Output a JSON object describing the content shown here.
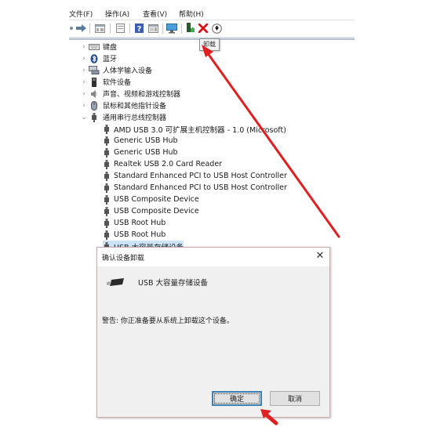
{
  "menubar": {
    "items": [
      {
        "label": "文件(F)",
        "display": "文件(F)"
      },
      {
        "label": "操作(A)"
      },
      {
        "label": "查看(V)"
      },
      {
        "label": "帮助(H)"
      }
    ]
  },
  "toolbar": {
    "buttons": [
      {
        "name": "back",
        "icon": "back-arrow-icon"
      },
      {
        "name": "forward",
        "icon": "forward-arrow-icon"
      },
      {
        "name": "show-hide-console-tree",
        "icon": "console-tree-icon"
      },
      {
        "name": "properties",
        "icon": "properties-icon"
      },
      {
        "name": "help",
        "icon": "help-icon"
      },
      {
        "name": "action-pane",
        "icon": "action-pane-icon"
      },
      {
        "name": "scan-hardware",
        "icon": "monitor-scan-icon"
      },
      {
        "name": "update-driver",
        "icon": "update-driver-icon"
      },
      {
        "name": "uninstall",
        "icon": "red-x-icon"
      },
      {
        "name": "disable",
        "icon": "down-arrow-circle-icon"
      }
    ],
    "tooltip": "卸载"
  },
  "tree": {
    "categories": [
      {
        "label": "键盘",
        "icon": "keyboard-icon",
        "expanded": false
      },
      {
        "label": "蓝牙",
        "icon": "bluetooth-icon",
        "expanded": false
      },
      {
        "label": "人体学输入设备",
        "icon": "hid-icon",
        "expanded": false
      },
      {
        "label": "软件设备",
        "icon": "software-device-icon",
        "expanded": false
      },
      {
        "label": "声音、视频和游戏控制器",
        "icon": "speaker-icon",
        "expanded": false
      },
      {
        "label": "鼠标和其他指针设备",
        "icon": "mouse-icon",
        "expanded": false
      },
      {
        "label": "通用串行总线控制器",
        "icon": "usb-plug-icon",
        "expanded": true
      }
    ],
    "usb_devices": [
      {
        "label": "AMD USB 3.0 可扩展主机控制器 - 1.0 (Microsoft)"
      },
      {
        "label": "Generic USB Hub"
      },
      {
        "label": "Generic USB Hub"
      },
      {
        "label": "Realtek USB 2.0 Card Reader"
      },
      {
        "label": "Standard Enhanced PCI to USB Host Controller"
      },
      {
        "label": "Standard Enhanced PCI to USB Host Controller"
      },
      {
        "label": "USB Composite Device"
      },
      {
        "label": "USB Composite Device"
      },
      {
        "label": "USB Root Hub"
      },
      {
        "label": "USB Root Hub"
      },
      {
        "label": "USB 大容量存储设备",
        "selected": true
      }
    ]
  },
  "dialog": {
    "title": "确认设备卸载",
    "close_label": "✕",
    "device_name": "USB 大容量存储设备",
    "warning": "警告: 你正准备要从系统上卸载这个设备。",
    "ok_label": "确定",
    "cancel_label": "取消"
  },
  "annotations": {
    "arrow_color": "#e02020"
  }
}
